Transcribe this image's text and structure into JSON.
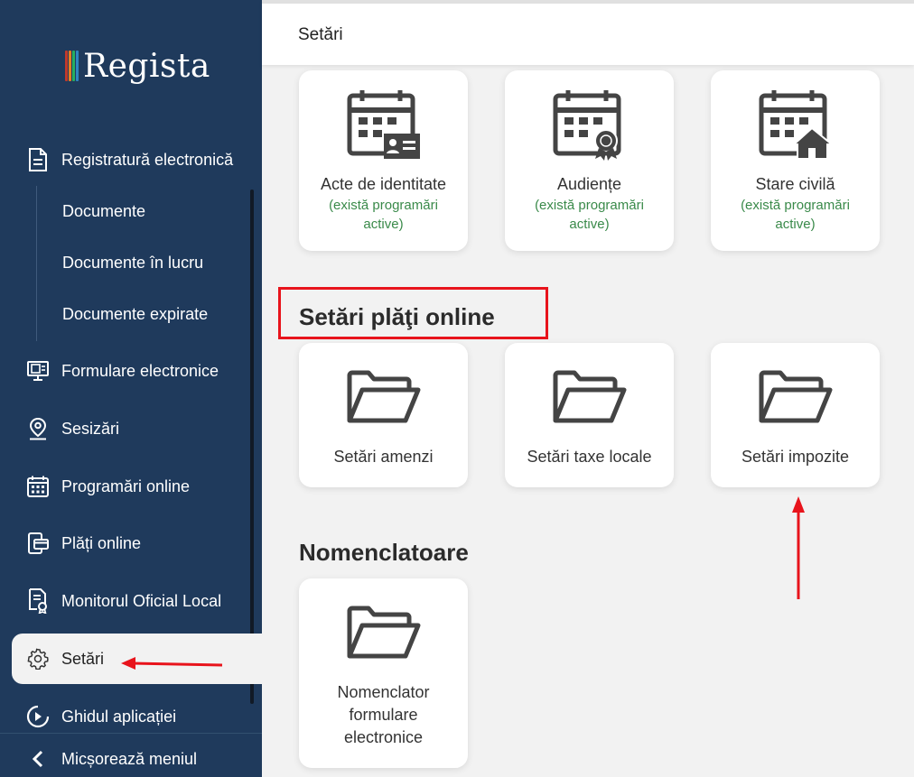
{
  "app": {
    "logo_text": "Regista"
  },
  "sidebar": {
    "registratura": {
      "label": "Registratură electronică",
      "icon": "document-icon"
    },
    "sub_items": [
      {
        "label": "Documente"
      },
      {
        "label": "Documente în lucru"
      },
      {
        "label": "Documente expirate"
      }
    ],
    "formulare": {
      "label": "Formulare electronice",
      "icon": "monitor-form-icon"
    },
    "sesizari": {
      "label": "Sesizări",
      "icon": "location-pin-icon"
    },
    "programari": {
      "label": "Programări online",
      "icon": "calendar-icon"
    },
    "plati": {
      "label": "Plăți online",
      "icon": "card-payment-icon"
    },
    "monitorul": {
      "label": "Monitorul Oficial Local",
      "icon": "certificate-document-icon"
    },
    "setari": {
      "label": "Setări",
      "icon": "gear-icon",
      "active": true
    },
    "ghidul": {
      "label": "Ghidul aplicației",
      "icon": "play-circle-icon"
    },
    "collapse": {
      "label": "Micșorează meniul",
      "icon": "chevron-left-icon"
    }
  },
  "header": {
    "title": "Setări"
  },
  "appointments": [
    {
      "title": "Acte de identitate",
      "status": "(există programări active)",
      "icon": "calendar-id-card-icon"
    },
    {
      "title": "Audiențe",
      "status": "(există programări active)",
      "icon": "calendar-award-icon"
    },
    {
      "title": "Stare civilă",
      "status": "(există programări active)",
      "icon": "calendar-home-icon"
    }
  ],
  "payments_section": {
    "title": "Setări plăţi online",
    "cards": [
      {
        "title": "Setări amenzi",
        "icon": "folder-icon"
      },
      {
        "title": "Setări taxe locale",
        "icon": "folder-icon"
      },
      {
        "title": "Setări impozite",
        "icon": "folder-icon"
      }
    ]
  },
  "nomenclatoare_section": {
    "title": "Nomenclatoare",
    "cards": [
      {
        "title": "Nomenclator formulare electronice",
        "icon": "folder-icon"
      }
    ]
  },
  "colors": {
    "sidebar_bg": "#1f3a5c",
    "status_green": "#3a8a4a",
    "annotation_red": "#e8141c"
  }
}
